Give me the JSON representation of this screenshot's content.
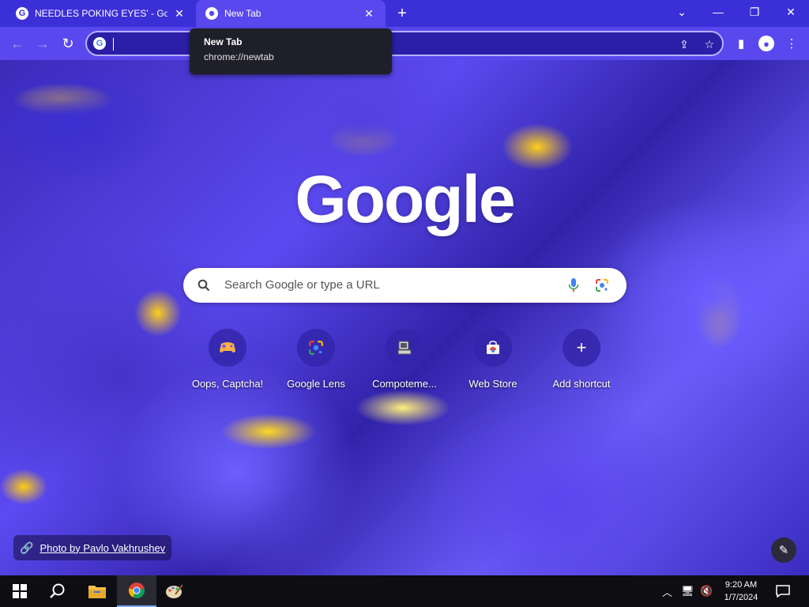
{
  "browser": {
    "tabs": [
      {
        "title": "NEEDLES POKING EYES' - Google",
        "favicon": "G"
      },
      {
        "title": "New Tab",
        "favicon": "chrome-icon"
      }
    ],
    "tooltip": {
      "title": "New Tab",
      "url": "chrome://newtab"
    },
    "omnibox_value": ""
  },
  "newtab": {
    "logo": "Google",
    "search_placeholder": "Search Google or type a URL",
    "shortcuts": [
      {
        "label": "Oops, Captcha!",
        "icon": "gamepad-icon"
      },
      {
        "label": "Google Lens",
        "icon": "lens-icon"
      },
      {
        "label": "Compoteme...",
        "icon": "computer-icon"
      },
      {
        "label": "Web Store",
        "icon": "web-store-icon"
      },
      {
        "label": "Add shortcut",
        "icon": "plus-icon"
      }
    ],
    "photo_credit": "Photo by Pavlo Vakhrushev"
  },
  "taskbar": {
    "time": "9:20 AM",
    "date": "1/7/2024"
  },
  "colors": {
    "tabstrip": "#3b2fd8",
    "toolbar": "#5848ee",
    "taskbar": "#0d0d12"
  }
}
